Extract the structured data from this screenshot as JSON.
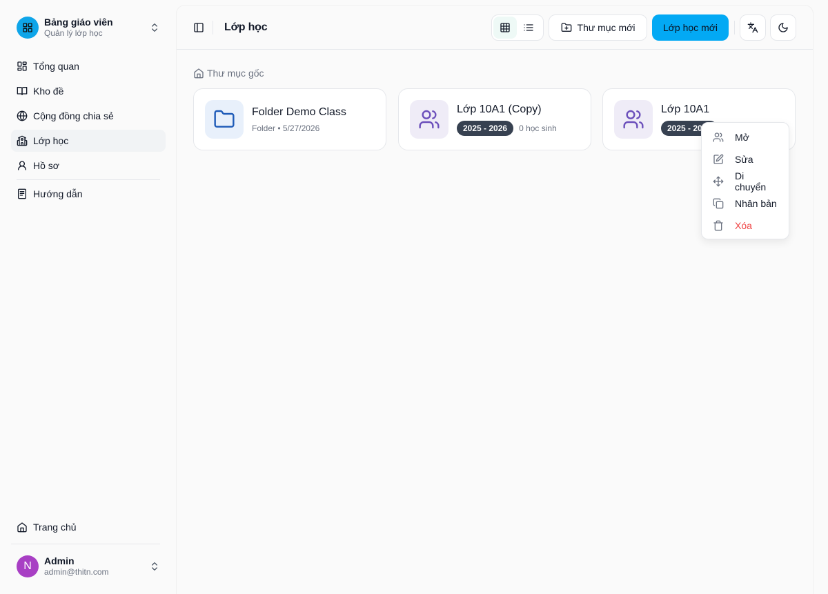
{
  "brand": {
    "title": "Bảng giáo viên",
    "subtitle": "Quản lý lớp học",
    "accent": "#0ea5e9"
  },
  "sidebar": {
    "items": [
      {
        "label": "Tổng quan",
        "icon": "dashboard-icon"
      },
      {
        "label": "Kho đề",
        "icon": "book-icon"
      },
      {
        "label": "Cộng đồng chia sẻ",
        "icon": "globe-icon"
      },
      {
        "label": "Lớp học",
        "icon": "school-icon",
        "active": true
      },
      {
        "label": "Hồ sơ",
        "icon": "user-icon"
      },
      {
        "label": "Hướng dẫn",
        "icon": "document-icon"
      }
    ],
    "home": "Trang chủ"
  },
  "user": {
    "initial": "N",
    "name": "Admin",
    "email": "admin@thitn.com",
    "avatar_color": "#a83fc4"
  },
  "header": {
    "title": "Lớp học",
    "new_folder": "Thư mục mới",
    "new_class": "Lớp học mới",
    "primary_color": "#03a9f4"
  },
  "breadcrumb": {
    "root": "Thư mục gốc"
  },
  "cards": [
    {
      "type": "folder",
      "title": "Folder Demo Class",
      "meta": "Folder • 5/27/2026"
    },
    {
      "type": "class",
      "title": "Lớp 10A1 (Copy)",
      "year": "2025 - 2026",
      "students": "0 học sinh"
    },
    {
      "type": "class",
      "title": "Lớp 10A1",
      "year": "2025 - 2026"
    }
  ],
  "context_menu": {
    "items": [
      {
        "label": "Mở",
        "icon": "users-icon"
      },
      {
        "label": "Sửa",
        "icon": "edit-icon"
      },
      {
        "label": "Di chuyển",
        "icon": "move-icon"
      },
      {
        "label": "Nhân bản",
        "icon": "copy-icon"
      },
      {
        "label": "Xóa",
        "icon": "trash-icon",
        "danger": true
      }
    ]
  }
}
